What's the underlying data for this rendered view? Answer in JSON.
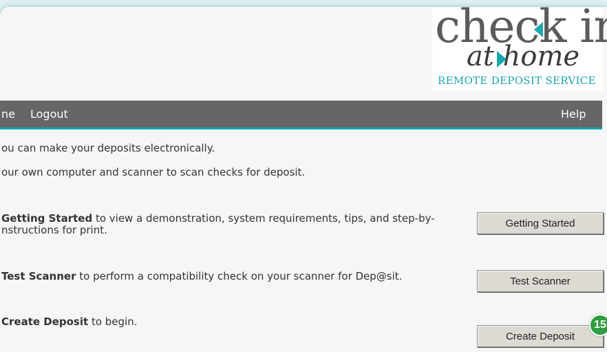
{
  "logo": {
    "line1": "check in",
    "tm": "™",
    "line2": "at home",
    "subtitle": "REMOTE DEPOSIT SERVICE"
  },
  "nav": {
    "left_item_partial": "ne",
    "logout": "Logout",
    "help": "Help"
  },
  "intro": {
    "line1": "ou can make your deposits electronically.",
    "line2": "our own computer and scanner to scan checks for deposit."
  },
  "sections": [
    {
      "bold": "Getting Started",
      "text": " to view a demonstration, system requirements, tips, and step-by-",
      "text2": "nstructions for print.",
      "button": "Getting Started"
    },
    {
      "bold": "Test Scanner",
      "text": " to perform a compatibility check on your scanner for Dep@sit.",
      "button": "Test Scanner"
    },
    {
      "bold": "Create Deposit",
      "text": " to begin.",
      "button": "Create Deposit"
    }
  ],
  "badge": "15",
  "colors": {
    "accent": "#1aa6ad",
    "navbar": "#666666",
    "badge": "#2e9d3f"
  }
}
